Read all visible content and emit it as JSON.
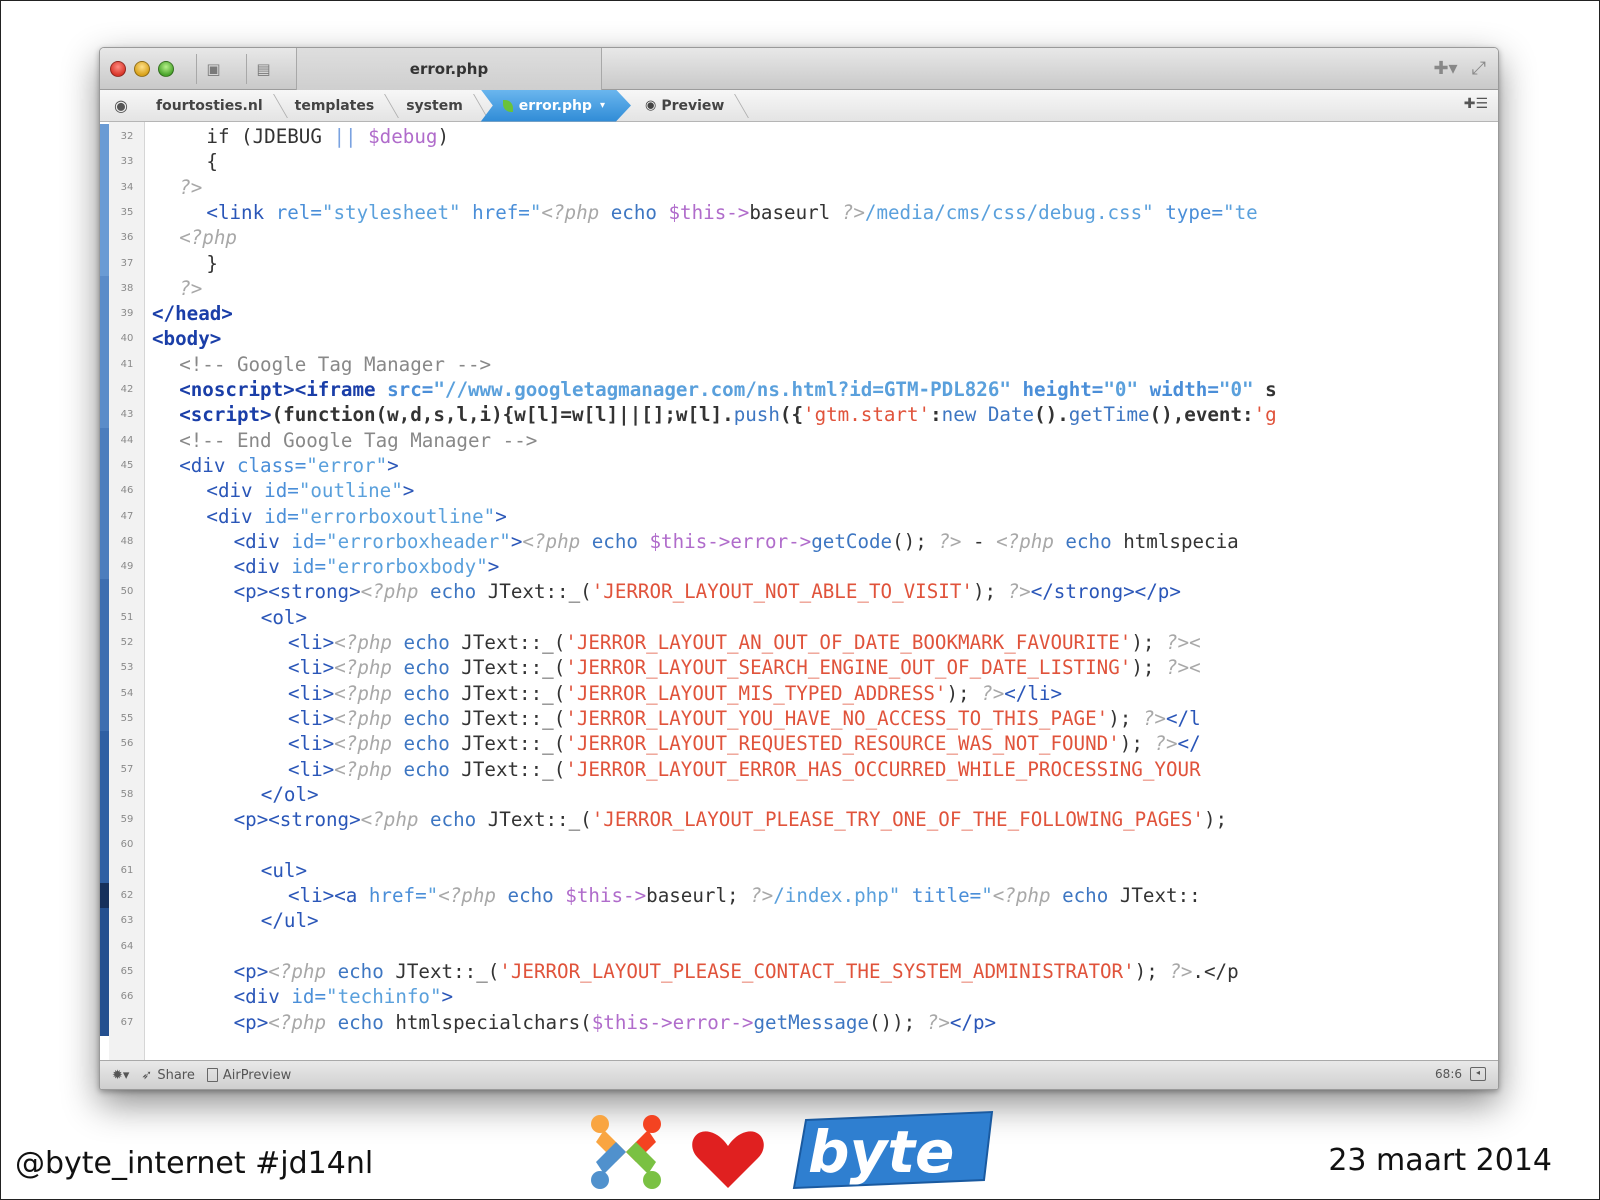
{
  "window": {
    "tab_title": "error.php"
  },
  "breadcrumb": {
    "items": [
      "fourtosties.nl",
      "templates",
      "system"
    ],
    "active": "error.php",
    "preview": "Preview"
  },
  "editor": {
    "lines": [
      {
        "n": "32"
      },
      {
        "n": "33"
      },
      {
        "n": "34"
      },
      {
        "n": "35"
      },
      {
        "n": "36"
      },
      {
        "n": "37"
      },
      {
        "n": "38"
      },
      {
        "n": "39"
      },
      {
        "n": "40"
      },
      {
        "n": "41"
      },
      {
        "n": "42"
      },
      {
        "n": "43"
      },
      {
        "n": "44"
      },
      {
        "n": "45"
      },
      {
        "n": "46"
      },
      {
        "n": "47"
      },
      {
        "n": "48"
      },
      {
        "n": "49"
      },
      {
        "n": "50"
      },
      {
        "n": "51"
      },
      {
        "n": "52"
      },
      {
        "n": "53"
      },
      {
        "n": "54"
      },
      {
        "n": "55"
      },
      {
        "n": "56"
      },
      {
        "n": "57"
      },
      {
        "n": "58"
      },
      {
        "n": "59"
      },
      {
        "n": "60"
      },
      {
        "n": "61"
      },
      {
        "n": "62"
      },
      {
        "n": "63"
      },
      {
        "n": "64"
      },
      {
        "n": "65"
      },
      {
        "n": "66"
      },
      {
        "n": "67"
      }
    ],
    "code": {
      "l32": [
        "if (JDEBUG ",
        "||",
        " $debug",
        ")"
      ],
      "l33": "{",
      "l34": "?>",
      "l35": [
        "<link ",
        "rel=",
        "\"stylesheet\"",
        " href=",
        "\"",
        "<?php",
        " echo ",
        "$this->",
        "baseurl ",
        "?>",
        "/media/cms/css/debug.css\"",
        " type=",
        "\"te"
      ],
      "l36": "<?php",
      "l37": "}",
      "l38": "?>",
      "l39": "</head>",
      "l40": "<body>",
      "l41": "<!-- Google Tag Manager -->",
      "l42": [
        "<noscript><iframe ",
        "src=",
        "\"//www.googletagmanager.com/ns.html?id=GTM-PDL826\"",
        " height=",
        "\"0\"",
        " width=",
        "\"0\"",
        " s"
      ],
      "l43": [
        "<script>",
        "(function(w,d,s,l,i){w[l]=w[l]||[];w[l].",
        "push",
        "({",
        "'gtm.start'",
        ":",
        "new ",
        "Date",
        "().",
        "getTime",
        "(),event:",
        "'g"
      ],
      "l44": "<!-- End Google Tag Manager -->",
      "l45": [
        "<div ",
        "class=",
        "\"error\"",
        ">"
      ],
      "l46": [
        "<div ",
        "id=",
        "\"outline\"",
        ">"
      ],
      "l47": [
        "<div ",
        "id=",
        "\"errorboxoutline\"",
        ">"
      ],
      "l48": [
        "<div ",
        "id=",
        "\"errorboxheader\"",
        ">",
        "<?php",
        " echo ",
        "$this->",
        "error->",
        "getCode",
        "(); ",
        "?>",
        " - ",
        "<?php",
        " echo ",
        "htmlspecia"
      ],
      "l49": [
        "<div ",
        "id=",
        "\"errorboxbody\"",
        ">"
      ],
      "l50": [
        "<p><strong>",
        "<?php",
        " echo ",
        "JText::_(",
        "'JERROR_LAYOUT_NOT_ABLE_TO_VISIT'",
        "); ",
        "?>",
        "</strong></p>"
      ],
      "l51": "<ol>",
      "l52": [
        "<li>",
        "<?php",
        " echo ",
        "JText::_(",
        "'JERROR_LAYOUT_AN_OUT_OF_DATE_BOOKMARK_FAVOURITE'",
        "); ",
        "?><"
      ],
      "l53": [
        "<li>",
        "<?php",
        " echo ",
        "JText::_(",
        "'JERROR_LAYOUT_SEARCH_ENGINE_OUT_OF_DATE_LISTING'",
        "); ",
        "?><"
      ],
      "l54": [
        "<li>",
        "<?php",
        " echo ",
        "JText::_(",
        "'JERROR_LAYOUT_MIS_TYPED_ADDRESS'",
        "); ",
        "?>",
        "</li>"
      ],
      "l55": [
        "<li>",
        "<?php",
        " echo ",
        "JText::_(",
        "'JERROR_LAYOUT_YOU_HAVE_NO_ACCESS_TO_THIS_PAGE'",
        "); ",
        "?>",
        "</l"
      ],
      "l56": [
        "<li>",
        "<?php",
        " echo ",
        "JText::_(",
        "'JERROR_LAYOUT_REQUESTED_RESOURCE_WAS_NOT_FOUND'",
        "); ",
        "?>",
        "</"
      ],
      "l57": [
        "<li>",
        "<?php",
        " echo ",
        "JText::_(",
        "'JERROR_LAYOUT_ERROR_HAS_OCCURRED_WHILE_PROCESSING_YOUR"
      ],
      "l58": "</ol>",
      "l59": [
        "<p><strong>",
        "<?php",
        " echo ",
        "JText::_(",
        "'JERROR_LAYOUT_PLEASE_TRY_ONE_OF_THE_FOLLOWING_PAGES'",
        ");"
      ],
      "l60": "",
      "l61": "<ul>",
      "l62": [
        "<li><a ",
        "href=",
        "\"",
        "<?php",
        " echo ",
        "$this->",
        "baseurl; ",
        "?>",
        "/index.php\"",
        " title=",
        "\"",
        "<?php",
        " echo ",
        "JText::"
      ],
      "l63": "</ul>",
      "l64": "",
      "l65": [
        "<p>",
        "<?php",
        " echo ",
        "JText::_(",
        "'JERROR_LAYOUT_PLEASE_CONTACT_THE_SYSTEM_ADMINISTRATOR'",
        "); ",
        "?>",
        ".</p"
      ],
      "l66": [
        "<div ",
        "id=",
        "\"techinfo\"",
        ">"
      ],
      "l67": [
        "<p>",
        "<?php",
        " echo ",
        "htmlspecialchars(",
        "$this->",
        "error->",
        "getMessage",
        "()); ",
        "?>",
        "</p>"
      ]
    }
  },
  "statusbar": {
    "share": "Share",
    "airpreview": "AirPreview",
    "position": "68:6"
  },
  "footer": {
    "handle": "@byte_internet #jd14nl",
    "date": "23 maart 2014",
    "brand": "byte"
  },
  "colors": {
    "tag": "#2a56b8",
    "string": "#e0533b",
    "variable": "#b06ccb",
    "accent_blue": "#2f8bd6"
  }
}
